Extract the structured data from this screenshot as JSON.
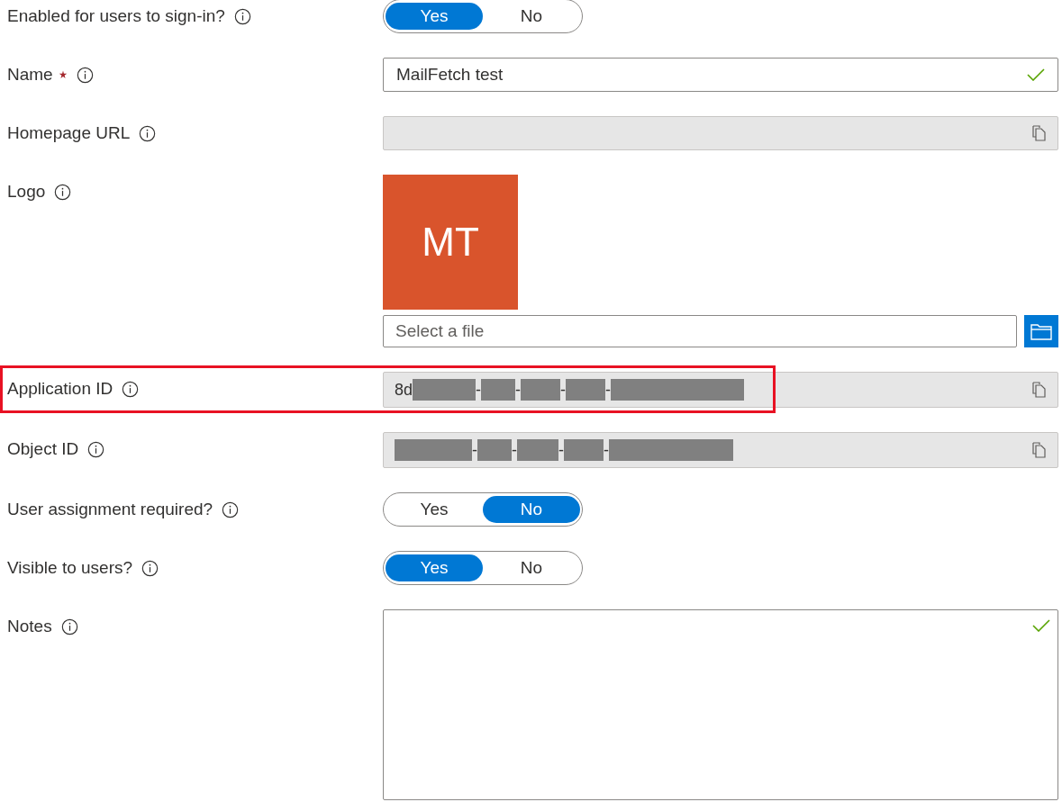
{
  "fields": [
    {
      "kind": "toggle",
      "label": "Enabled for users to sign-in?",
      "required": false,
      "highlighted": false,
      "options": [
        {
          "label": "Yes",
          "selected": true
        },
        {
          "label": "No",
          "selected": false
        }
      ]
    },
    {
      "kind": "text",
      "label": "Name",
      "required": true,
      "highlighted": false,
      "value": "MailFetch test",
      "valid": true
    },
    {
      "kind": "readonly",
      "label": "Homepage URL",
      "required": false,
      "highlighted": false
    },
    {
      "kind": "logo",
      "label": "Logo",
      "required": false,
      "highlighted": false,
      "logo_text": "MT",
      "file_placeholder": "Select a file"
    },
    {
      "kind": "id",
      "label": "Application ID",
      "required": false,
      "highlighted": true,
      "segments": [
        {
          "kind": "text",
          "text": "8d"
        },
        {
          "kind": "redacted"
        },
        {
          "kind": "text",
          "text": "-"
        },
        {
          "kind": "redacted"
        },
        {
          "kind": "text",
          "text": "-"
        },
        {
          "kind": "redacted"
        },
        {
          "kind": "text",
          "text": "-"
        },
        {
          "kind": "redacted"
        },
        {
          "kind": "text",
          "text": "-"
        },
        {
          "kind": "redacted"
        }
      ]
    },
    {
      "kind": "id",
      "label": "Object ID",
      "required": false,
      "highlighted": false,
      "segments": [
        {
          "kind": "redacted"
        },
        {
          "kind": "text",
          "text": "-"
        },
        {
          "kind": "redacted"
        },
        {
          "kind": "text",
          "text": "-"
        },
        {
          "kind": "redacted"
        },
        {
          "kind": "text",
          "text": "-"
        },
        {
          "kind": "redacted"
        },
        {
          "kind": "text",
          "text": "-"
        },
        {
          "kind": "redacted"
        }
      ]
    },
    {
      "kind": "toggle",
      "label": "User assignment required?",
      "required": false,
      "highlighted": false,
      "options": [
        {
          "label": "Yes",
          "selected": false
        },
        {
          "label": "No",
          "selected": true
        }
      ]
    },
    {
      "kind": "toggle",
      "label": "Visible to users?",
      "required": false,
      "highlighted": false,
      "options": [
        {
          "label": "Yes",
          "selected": true
        },
        {
          "label": "No",
          "selected": false
        }
      ]
    },
    {
      "kind": "textarea",
      "label": "Notes",
      "required": false,
      "highlighted": false,
      "valid": true
    }
  ]
}
